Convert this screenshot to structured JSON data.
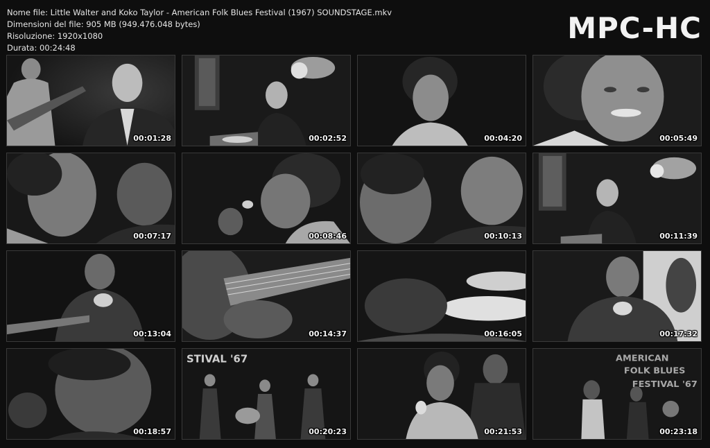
{
  "info": {
    "filename": "Nome file: Little Walter and Koko Taylor - American Folk Blues Festival (1967) SOUNDSTAGE.mkv",
    "filesize": "Dimensioni del file: 905 MB (949.476.048 bytes)",
    "resolution": "Risoluzione: 1920x1080",
    "duration": "Durata: 00:24:48"
  },
  "logo": "MPC-HC",
  "thumbnails": [
    {
      "time": "00:01:28"
    },
    {
      "time": "00:02:52"
    },
    {
      "time": "00:04:20"
    },
    {
      "time": "00:05:49"
    },
    {
      "time": "00:07:17"
    },
    {
      "time": "00:08:46"
    },
    {
      "time": "00:10:13"
    },
    {
      "time": "00:11:39"
    },
    {
      "time": "00:13:04"
    },
    {
      "time": "00:14:37"
    },
    {
      "time": "00:16:05"
    },
    {
      "time": "00:17:32"
    },
    {
      "time": "00:18:57"
    },
    {
      "time": "00:20:23"
    },
    {
      "time": "00:21:53"
    },
    {
      "time": "00:23:18"
    }
  ]
}
